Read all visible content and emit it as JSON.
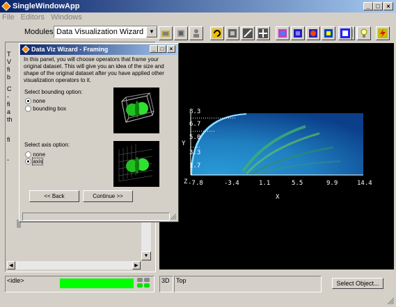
{
  "app": {
    "title": "SingleWindowApp"
  },
  "menu": {
    "items": [
      "File",
      "Editors",
      "Windows"
    ]
  },
  "modules": {
    "label": "Modules",
    "selected": "Data Visualization Wizard"
  },
  "toolbar": {
    "icons": [
      "scene-icon",
      "render-icon",
      "user-icon",
      "refresh-icon",
      "select-icon",
      "line-icon",
      "cross-icon",
      "color-cube-icon",
      "blue-square-icon",
      "red-dot-icon",
      "color-box-icon",
      "panel-icon",
      "image-icon",
      "layout-icon",
      "square-frame-icon",
      "bulb-icon",
      "lightning-icon"
    ]
  },
  "wizard": {
    "title": "Data Viz Wizard - Framing",
    "description": "In this panel, you will choose operators that frame your original dataset. This will give you an idea of the size and shape of the original dataset after you have applied other visualization operators to it.",
    "bounding_label": "Select bounding option:",
    "bounding_options": [
      {
        "label": "none",
        "selected": true
      },
      {
        "label": "bounding box",
        "selected": false
      }
    ],
    "axis_label": "Select axis option:",
    "axis_options": [
      {
        "label": "none",
        "selected": false
      },
      {
        "label": "axis",
        "selected": true
      }
    ],
    "back_label": "<< Back",
    "continue_label": "Continue >>"
  },
  "leftpanel": {
    "letters": [
      "T",
      "V",
      "fi",
      "b",
      "",
      "C",
      "",
      "-",
      "fi",
      "a",
      "th",
      "",
      "fi",
      "",
      "",
      "-"
    ]
  },
  "viewport": {
    "x_ticks": [
      "-7.8",
      "-3.4",
      "1.1",
      "5.5",
      "9.9",
      "14.4"
    ],
    "y_ticks": [
      "8.3",
      "6.7",
      "5.0",
      "3.3",
      "1.7"
    ],
    "xlabel": "X",
    "ylabel": "Y",
    "zlabel": "Z"
  },
  "status": {
    "idle": "<idle>",
    "view_mode": "3D",
    "view_name": "Top",
    "select_label": "Select Object..."
  },
  "colors": {
    "accent": "#0a246a",
    "progress": "#00ff00",
    "viewport_bg": "#000000"
  }
}
